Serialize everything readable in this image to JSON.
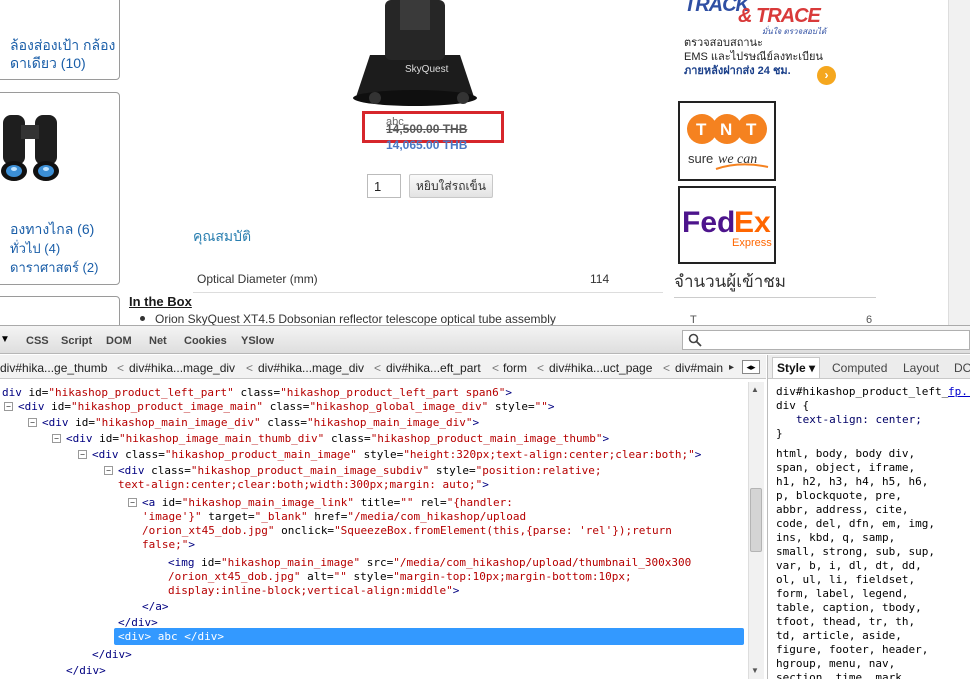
{
  "colors": {
    "accent_red": "#d6262b",
    "selection": "#3399ff",
    "link_blue": "#1a5ea8"
  },
  "sidebar": {
    "cat1_line1": "ล้องส่องเป้า กล้อง",
    "cat1_line2": "ดาเดียว (10)",
    "cat2_line1": "องทางไกล (6)",
    "cat2_line2": "ทั่วไป (4)",
    "cat2_line3": "ดาราศาสตร์ (2)"
  },
  "product": {
    "price_note": "abc",
    "price_old": "14,500.00 THB",
    "price_new": "14,065.00 THB",
    "quantity": "1",
    "add_to_cart": "หยิบใส่รถเข็น",
    "properties_title": "คุณสมบัติ",
    "properties": [
      {
        "label": "Optical Diameter (mm)",
        "value": "114"
      }
    ],
    "in_the_box_title": "In the Box",
    "in_the_box_item": "Orion SkyQuest XT4.5 Dobsonian reflector telescope optical tube assembly"
  },
  "right_col": {
    "track_title": "TRACK",
    "track_amp": "& TRACE",
    "track_sub": "มั่นใจ ตรวจสอบได้",
    "track_l1": "ตรวจสอบสถานะ",
    "track_l2": "EMS และไปรษณีย์ลงทะเบียน",
    "track_l3": "ภายหลังฝากส่ง 24 ชม.",
    "visitors_title": "จำนวนผู้เข้าชม",
    "visitors_row": "T",
    "visitors_count": "6"
  },
  "firebug": {
    "tabs": [
      "CSS",
      "Script",
      "DOM",
      "Net",
      "Cookies",
      "YSlow"
    ],
    "breadcrumbs": [
      "div#hika...ge_thumb",
      "div#hika...mage_div",
      "div#hika...mage_div",
      "div#hika...eft_part",
      "form",
      "div#hika...uct_page",
      "div#main"
    ],
    "selected_line": "<div> abc </div>",
    "side_tabs": [
      "Style",
      "Computed",
      "Layout",
      "DO"
    ],
    "css_selector": "div#hikashop_product_left_",
    "css_selector_2": "div {",
    "css_link": "fp...",
    "css_rule": "text-align: center;",
    "css_close": "}",
    "css_inherited": [
      "html, body, body div,",
      "span, object, iframe,",
      "h1, h2, h3, h4, h5, h6,",
      "p, blockquote, pre,",
      "abbr, address, cite,",
      "code, del, dfn, em, img,",
      "ins, kbd, q, samp,",
      "small, strong, sub, sup,",
      "var, b, i, dl, dt, dd,",
      "ol, ul, li, fieldset,",
      "form, label, legend,",
      "table, caption, tbody,",
      "tfoot, thead, tr, th,",
      "td, article, aside,",
      "figure, footer, header,",
      "hgroup, menu, nav,",
      "section, time, mark"
    ]
  }
}
